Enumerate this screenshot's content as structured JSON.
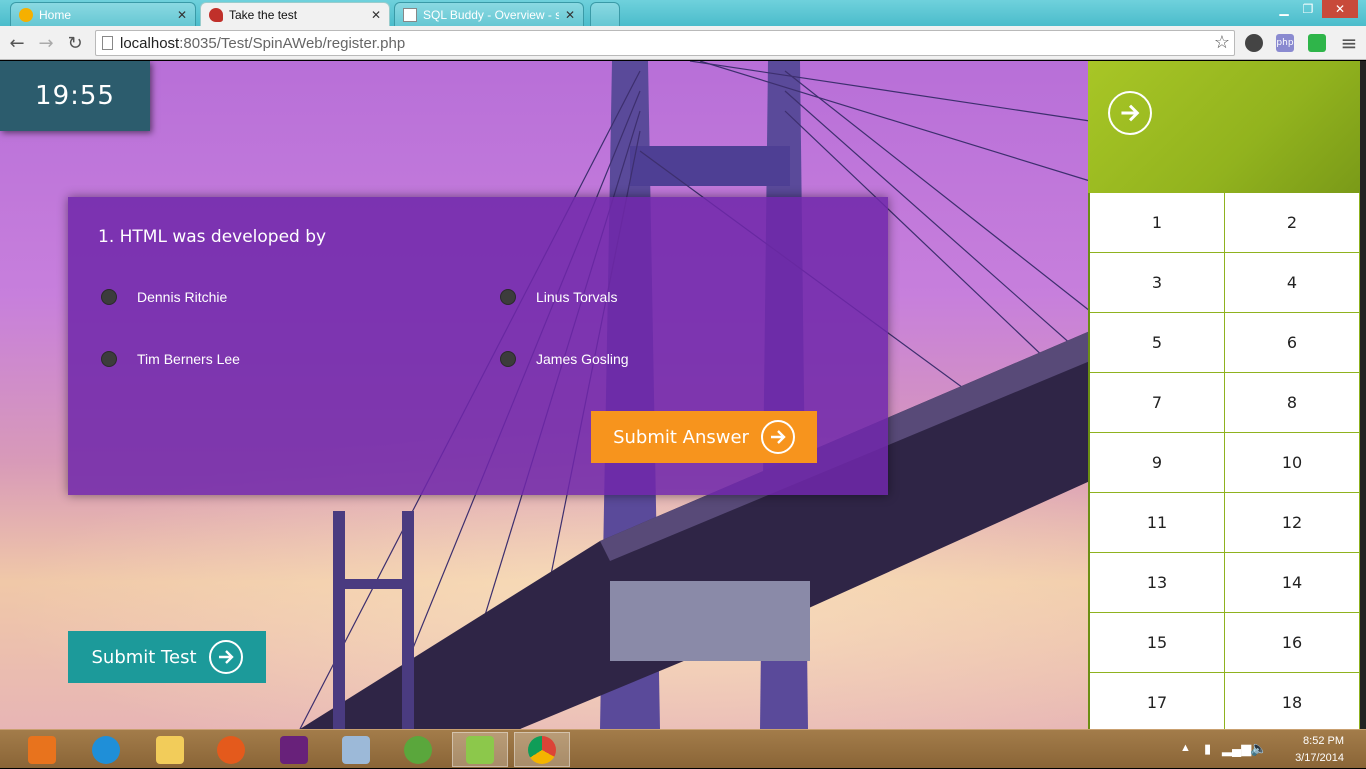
{
  "browser": {
    "tabs": [
      {
        "label": "Home",
        "active": false
      },
      {
        "label": "Take the test",
        "active": true
      },
      {
        "label": "SQL Buddy - Overview - s",
        "active": false
      }
    ],
    "address": {
      "host": "localhost",
      "path": ":8035/Test/SpinAWeb/register.php"
    },
    "ext_php_label": "php"
  },
  "timer": "19:55",
  "question": {
    "text": "1. HTML was developed by",
    "options": [
      "Dennis Ritchie",
      "Linus Torvals",
      "Tim Berners Lee",
      "James Gosling"
    ]
  },
  "buttons": {
    "submit_answer": "Submit Answer",
    "submit_test": "Submit Test"
  },
  "question_nav": [
    "1",
    "2",
    "3",
    "4",
    "5",
    "6",
    "7",
    "8",
    "9",
    "10",
    "11",
    "12",
    "13",
    "14",
    "15",
    "16",
    "17",
    "18"
  ],
  "taskbar": {
    "time": "8:52 PM",
    "date": "3/17/2014"
  },
  "colors": {
    "question_card": "#7028aa",
    "submit_answer": "#f7941d",
    "submit_test": "#1c9a9a",
    "panel_accent": "#92b31e",
    "timer": "#2c5c6d"
  }
}
